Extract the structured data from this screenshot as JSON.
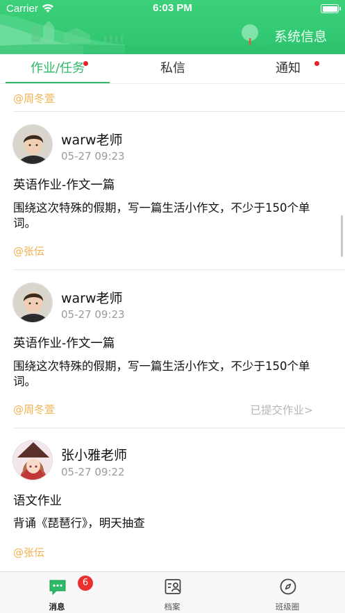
{
  "status_bar": {
    "carrier": "Carrier",
    "time": "6:03 PM"
  },
  "header": {
    "title": "系统信息"
  },
  "tabs": [
    {
      "label": "作业/任务",
      "active": true,
      "has_dot": true
    },
    {
      "label": "私信",
      "active": false,
      "has_dot": false
    },
    {
      "label": "通知",
      "active": false,
      "has_dot": true
    }
  ],
  "feed": {
    "top_mention": "@周冬萱",
    "posts": [
      {
        "author": "warw老师",
        "time": "05-27 09:23",
        "title": "英语作业-作文一篇",
        "body": "围绕这次特殊的假期，写一篇生活小作文，不少于150个单词。",
        "mention": "@张伝",
        "status": ""
      },
      {
        "author": "warw老师",
        "time": "05-27 09:23",
        "title": "英语作业-作文一篇",
        "body": "围绕这次特殊的假期，写一篇生活小作文，不少于150个单词。",
        "mention": "@周冬萱",
        "status": "已提交作业>"
      },
      {
        "author": "张小雅老师",
        "time": "05-27 09:22",
        "title": "语文作业",
        "body": "背诵《琵琶行》，明天抽查",
        "mention": "@张伝",
        "status": ""
      }
    ]
  },
  "tabbar": {
    "items": [
      {
        "label": "消息",
        "icon": "message-icon",
        "badge": "6",
        "active": true
      },
      {
        "label": "档案",
        "icon": "profile-file-icon",
        "active": false
      },
      {
        "label": "班级圈",
        "icon": "compass-icon",
        "active": false
      }
    ]
  },
  "colors": {
    "accent": "#2db967",
    "mention": "#f0b14e",
    "badge": "#e8302f",
    "header_green": "#34c975"
  }
}
